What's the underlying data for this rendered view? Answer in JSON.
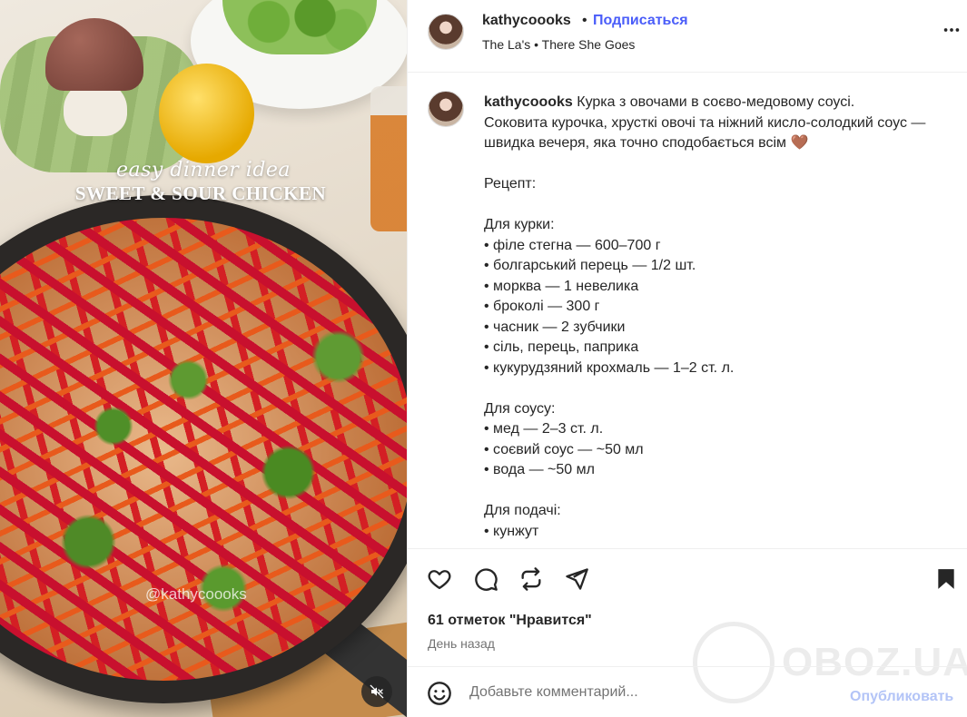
{
  "media": {
    "caption_line1": "easy dinner idea",
    "caption_line2": "SWEET & SOUR CHICKEN",
    "watermark": "@kathycoooks",
    "mute_icon": "speaker-muted-icon"
  },
  "header": {
    "username": "kathycoooks",
    "separator": "•",
    "follow_label": "Подписаться",
    "music": "The La's • There She Goes",
    "more_icon": "more-horizontal-icon"
  },
  "post": {
    "author": "kathycoooks",
    "text": "Курка з овочами в соєво-медовому соусі.\nСоковита курочка, хрусткі овочі та ніжний кисло-солодкий соус — швидка вечеря, яка точно сподобається всім 🤎\n\nРецепт:\n\nДля курки:\n• філе стегна — 600–700 г\n• болгарський перець — 1/2 шт.\n• морква — 1 невелика\n• броколі — 300 г\n• часник — 2 зубчики\n• сіль, перець, паприка\n• кукурудзяний крохмаль — 1–2 ст. л.\n\nДля соусу:\n• мед — 2–3 ст. л.\n• соєвий соус — ~50 мл\n• вода — ~50 мл\n\nДля подачі:\n• кунжут"
  },
  "actions": {
    "icons": [
      "heart-icon",
      "comment-icon",
      "repost-icon",
      "share-icon",
      "bookmark-icon"
    ],
    "likes": "61 отметок \"Нравится\"",
    "time": "День назад"
  },
  "watermark_site": "OBOZ.UA",
  "comment_box": {
    "placeholder": "Добавьте комментарий...",
    "publish_label": "Опубликовать",
    "emoji_icon": "emoji-icon"
  },
  "colors": {
    "accent": "#4a5df9",
    "publish_disabled": "#b3c4f7",
    "text": "#262626",
    "muted": "#737373"
  }
}
